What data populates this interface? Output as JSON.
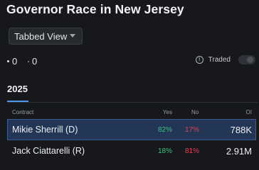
{
  "header": {
    "title": "Governor Race in New Jersey"
  },
  "view_select": {
    "value": "Tabbed View"
  },
  "counters": [
    {
      "value": "0"
    },
    {
      "value": "0"
    }
  ],
  "traded": {
    "label": "Traded",
    "enabled": false
  },
  "tabs": [
    {
      "label": "2025",
      "active": true
    }
  ],
  "table": {
    "columns": {
      "contract": "Contract",
      "yes": "Yes",
      "no": "No",
      "oi": "OI"
    },
    "rows": [
      {
        "name": "Mikie Sherrill (D)",
        "yes": "82%",
        "no": "17%",
        "oi": "788K",
        "selected": true
      },
      {
        "name": "Jack Ciattarelli (R)",
        "yes": "18%",
        "no": "81%",
        "oi": "2.91M",
        "selected": false
      }
    ]
  },
  "colors": {
    "accent": "#4a9ae8",
    "yes": "#36c47a",
    "no": "#e8405b",
    "selected_row": "#243655"
  }
}
